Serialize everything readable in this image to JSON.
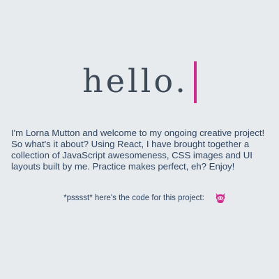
{
  "header": {
    "title": "hello."
  },
  "intro": {
    "text": "I'm Lorna Mutton and welcome to my ongoing creative project! So what's it about? Using React, I have brought together a collection of JavaScript awesomeness, CSS images and UI layouts built by me. Practice makes perfect, eh? Enjoy!"
  },
  "footer": {
    "code_text": "*psssst* here's the code for this project:",
    "icon": "github-octocat-icon"
  },
  "colors": {
    "background": "#e8ebee",
    "accent": "#cc2e8f",
    "text": "#2f4561",
    "headline": "#3f4a59"
  }
}
